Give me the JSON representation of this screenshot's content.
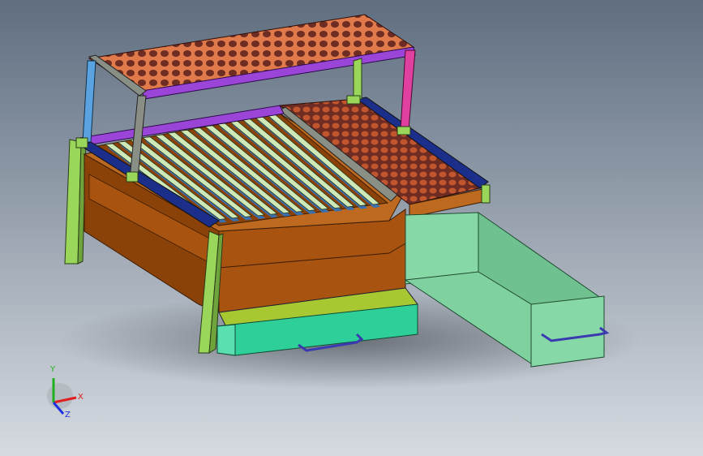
{
  "viewport": {
    "background_top": "#5f6e80",
    "background_bottom": "#d6dbe1"
  },
  "model": {
    "colors": {
      "body": "#a85410",
      "body_dark": "#8a4208",
      "body_top": "#bd6a20",
      "slat": "#cfe8b8",
      "slat_shadow": "#3a6fb0",
      "frame_green": "#9ad65a",
      "frame_blue": "#5aa3e0",
      "frame_gray": "#8a8f86",
      "frame_pink": "#e040a0",
      "frame_purple": "#9b45d8",
      "frame_navy": "#1b2f8a",
      "rack_orange": "#e07a4a",
      "rack_dark": "#6e2c22",
      "drawer_teal": "#2fcf9a",
      "drawer_mint": "#86d9a6",
      "handle": "#3a3ab0",
      "strip_lime": "#a8c832"
    }
  },
  "triad": {
    "x_label": "X",
    "y_label": "Y",
    "z_label": "Z",
    "x_color": "#e02020",
    "y_color": "#20b020",
    "z_color": "#2030e0"
  }
}
